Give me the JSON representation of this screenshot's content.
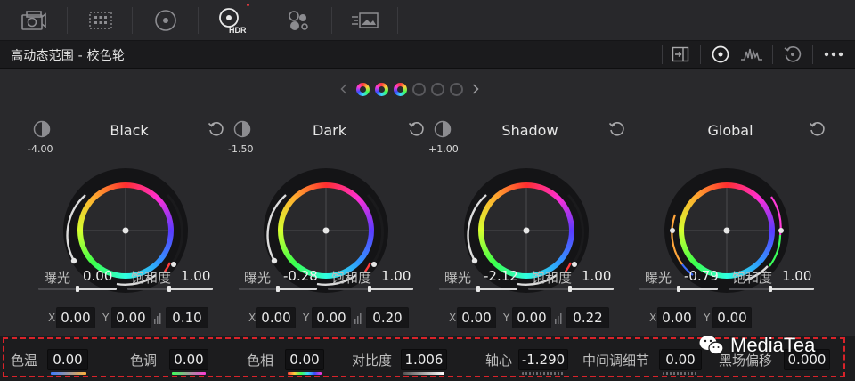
{
  "toolbar": {
    "items": [
      {
        "name": "camera-raw",
        "icon": "camera-raw-icon"
      },
      {
        "name": "color-match",
        "icon": "color-match-icon"
      },
      {
        "name": "primaries",
        "icon": "primaries-wheel-icon"
      },
      {
        "name": "hdr",
        "icon": "hdr-wheel-icon",
        "label": "HDR"
      },
      {
        "name": "rgb-mixer",
        "icon": "rgb-mixer-icon"
      },
      {
        "name": "motion-effects",
        "icon": "motion-effects-icon"
      }
    ],
    "accent": "#e0393e"
  },
  "header": {
    "title": "高动态范围 - 校色轮"
  },
  "pager": {
    "prev": "‹",
    "next": "›",
    "dots": 6,
    "active_dots": 3
  },
  "wheels": [
    {
      "title": "Black",
      "wheel_value": "-4.00",
      "exposure_label": "曝光",
      "exposure": "0.00",
      "saturation_label": "饱和度",
      "saturation": "1.00",
      "x": "0.00",
      "y": "0.00",
      "z": "0.10"
    },
    {
      "title": "Dark",
      "wheel_value": "-1.50",
      "exposure_label": "曝光",
      "exposure": "-0.28",
      "saturation_label": "饱和度",
      "saturation": "1.00",
      "x": "0.00",
      "y": "0.00",
      "z": "0.20"
    },
    {
      "title": "Shadow",
      "wheel_value": "+1.00",
      "exposure_label": "曝光",
      "exposure": "-2.12",
      "saturation_label": "饱和度",
      "saturation": "1.00",
      "x": "0.00",
      "y": "0.00",
      "z": "0.22"
    },
    {
      "title": "Global",
      "wheel_value": "",
      "exposure_label": "曝光",
      "exposure": "-0.79",
      "saturation_label": "饱和度",
      "saturation": "1.00",
      "x": "0.00",
      "y": "0.00",
      "z": ""
    }
  ],
  "xy_labels": {
    "x": "X",
    "y": "Y"
  },
  "bottom": [
    {
      "label": "色温",
      "value": "0.00"
    },
    {
      "label": "色调",
      "value": "0.00"
    },
    {
      "label": "色相",
      "value": "0.00"
    },
    {
      "label": "对比度",
      "value": "1.006"
    },
    {
      "label": "轴心",
      "value": "-1.290"
    },
    {
      "label": "中间调细节",
      "value": "0.00"
    },
    {
      "label": "黑场偏移",
      "value": "0.000"
    }
  ],
  "watermark": {
    "text": "MediaTea"
  }
}
